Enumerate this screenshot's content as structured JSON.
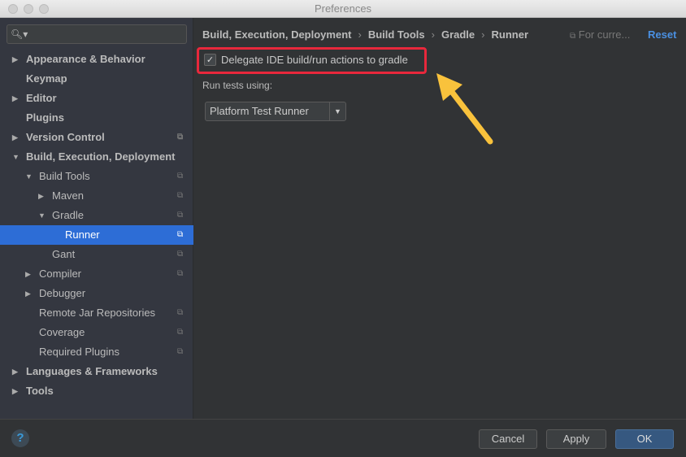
{
  "window": {
    "title": "Preferences"
  },
  "sidebar": {
    "search_placeholder": "",
    "items": [
      {
        "label": "Appearance & Behavior",
        "level": 0,
        "arrow": "right",
        "bold": true,
        "copy": false
      },
      {
        "label": "Keymap",
        "level": 0,
        "arrow": "",
        "bold": true,
        "copy": false
      },
      {
        "label": "Editor",
        "level": 0,
        "arrow": "right",
        "bold": true,
        "copy": false
      },
      {
        "label": "Plugins",
        "level": 0,
        "arrow": "",
        "bold": true,
        "copy": false
      },
      {
        "label": "Version Control",
        "level": 0,
        "arrow": "right",
        "bold": true,
        "copy": true
      },
      {
        "label": "Build, Execution, Deployment",
        "level": 0,
        "arrow": "down",
        "bold": true,
        "copy": false
      },
      {
        "label": "Build Tools",
        "level": 1,
        "arrow": "down",
        "bold": false,
        "copy": true
      },
      {
        "label": "Maven",
        "level": 2,
        "arrow": "right",
        "bold": false,
        "copy": true
      },
      {
        "label": "Gradle",
        "level": 2,
        "arrow": "down",
        "bold": false,
        "copy": true
      },
      {
        "label": "Runner",
        "level": 3,
        "arrow": "",
        "bold": false,
        "copy": true,
        "selected": true
      },
      {
        "label": "Gant",
        "level": 2,
        "arrow": "",
        "bold": false,
        "copy": true
      },
      {
        "label": "Compiler",
        "level": 1,
        "arrow": "right",
        "bold": false,
        "copy": true
      },
      {
        "label": "Debugger",
        "level": 1,
        "arrow": "right",
        "bold": false,
        "copy": false
      },
      {
        "label": "Remote Jar Repositories",
        "level": 1,
        "arrow": "",
        "bold": false,
        "copy": true
      },
      {
        "label": "Coverage",
        "level": 1,
        "arrow": "",
        "bold": false,
        "copy": true
      },
      {
        "label": "Required Plugins",
        "level": 1,
        "arrow": "",
        "bold": false,
        "copy": true
      },
      {
        "label": "Languages & Frameworks",
        "level": 0,
        "arrow": "right",
        "bold": true,
        "copy": false
      },
      {
        "label": "Tools",
        "level": 0,
        "arrow": "right",
        "bold": true,
        "copy": false
      }
    ]
  },
  "main": {
    "breadcrumb": [
      "Build, Execution, Deployment",
      "Build Tools",
      "Gradle",
      "Runner"
    ],
    "for_current": "For curre...",
    "reset": "Reset",
    "delegate_checkbox": {
      "label": "Delegate IDE build/run actions to gradle",
      "checked": true
    },
    "run_tests_label": "Run tests using:",
    "run_tests_value": "Platform Test Runner"
  },
  "footer": {
    "help": "?",
    "cancel": "Cancel",
    "apply": "Apply",
    "ok": "OK"
  },
  "colors": {
    "highlight": "#e8283c",
    "arrow_annotation": "#f9c23c",
    "selection": "#2d6dd6",
    "link": "#4a90e2"
  }
}
